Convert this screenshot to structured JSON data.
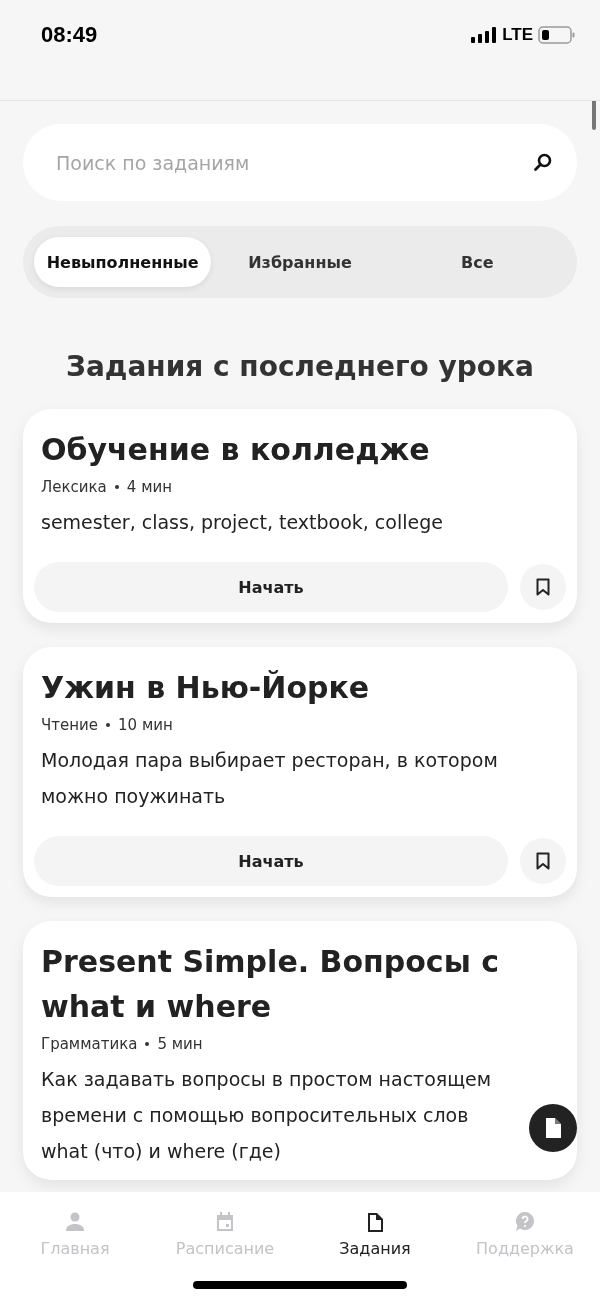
{
  "status_bar": {
    "time": "08:49",
    "network": "LTE"
  },
  "search": {
    "placeholder": "Поиск по заданиям"
  },
  "filters": [
    {
      "label": "Невыполненные",
      "selected": true
    },
    {
      "label": "Избранные",
      "selected": false
    },
    {
      "label": "Все",
      "selected": false
    }
  ],
  "section_title": "Задания с последнего урока",
  "tasks": [
    {
      "title": "Обучение в колледже",
      "category": "Лексика",
      "duration": "4 мин",
      "description": "semester, class, project, textbook, college",
      "button": "Начать",
      "bookmarked": false
    },
    {
      "title": "Ужин в Нью-Йорке",
      "category": "Чтение",
      "duration": "10 мин",
      "description": "Молодая пара выбирает ресторан, в котором можно поужинать",
      "button": "Начать",
      "bookmarked": false
    },
    {
      "title": "Present Simple. Вопросы с what и where",
      "category": "Грамматика",
      "duration": "5 мин",
      "description": "Как задавать вопросы в простом настоящем времени с помощью вопросительных слов what (что) и where (где)"
    }
  ],
  "nav": [
    {
      "label": "Главная",
      "selected": false
    },
    {
      "label": "Расписание",
      "selected": false
    },
    {
      "label": "Задания",
      "selected": true
    },
    {
      "label": "Поддержка",
      "selected": false
    }
  ]
}
